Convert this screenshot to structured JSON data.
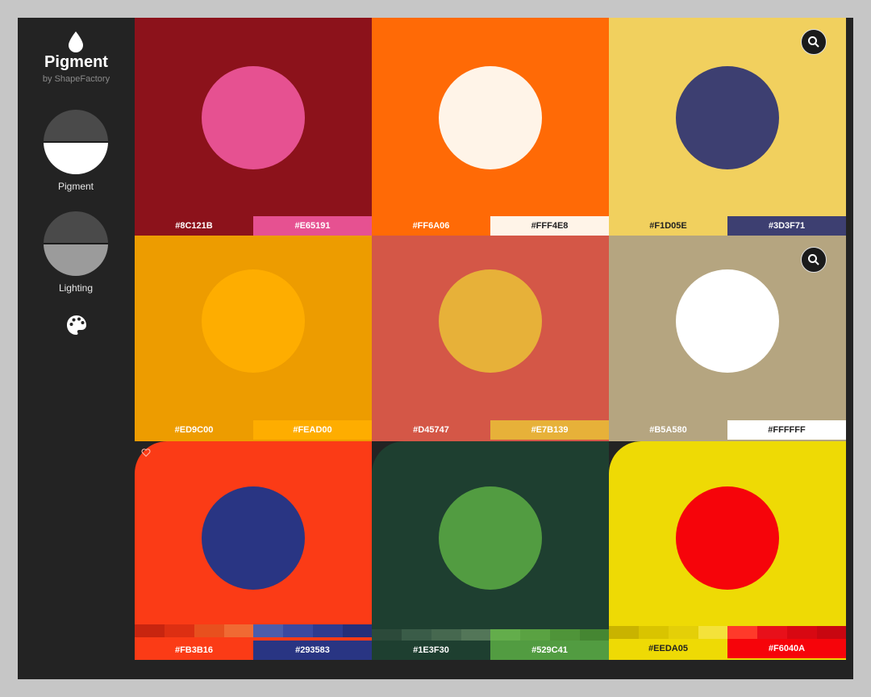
{
  "app": {
    "title": "Pigment",
    "subtitle": "by ShapeFactory"
  },
  "sidebar": {
    "tools": [
      {
        "label": "Pigment",
        "icon": "pigment-disc-icon"
      },
      {
        "label": "Lighting",
        "icon": "lighting-disc-icon"
      }
    ],
    "palette_icon": "palette-icon",
    "drop_icon": "drop-icon"
  },
  "colors": {
    "app_bg": "#232323",
    "page_bg": "#c6c6c6"
  },
  "grid": {
    "tiles": [
      {
        "bg": "#8C121B",
        "circle": "#E65191",
        "left_chip": "#8C121B",
        "right_chip": "#E65191",
        "left_text": "#ffffff",
        "right_text": "#ffffff",
        "zoom": false,
        "heart": false
      },
      {
        "bg": "#FF6A06",
        "circle": "#FFF4E8",
        "left_chip": "#FF6A06",
        "right_chip": "#FFF4E8",
        "left_text": "#ffffff",
        "right_text": "#222222",
        "zoom": false,
        "heart": false
      },
      {
        "bg": "#F1D05E",
        "circle": "#3D3F71",
        "left_chip": "#F1D05E",
        "right_chip": "#3D3F71",
        "left_text": "#222222",
        "right_text": "#ffffff",
        "zoom": true,
        "heart": false
      },
      {
        "bg": "#ED9C00",
        "circle": "#FEAD00",
        "left_chip": "#ED9C00",
        "right_chip": "#FEAD00",
        "left_text": "#ffffff",
        "right_text": "#ffffff",
        "zoom": false,
        "heart": false
      },
      {
        "bg": "#D45747",
        "circle": "#E7B139",
        "left_chip": "#D45747",
        "right_chip": "#E7B139",
        "left_text": "#ffffff",
        "right_text": "#ffffff",
        "zoom": false,
        "heart": false
      },
      {
        "bg": "#B5A580",
        "circle": "#FFFFFF",
        "left_chip": "#B5A580",
        "right_chip": "#FFFFFF",
        "left_text": "#ffffff",
        "right_text": "#222222",
        "zoom": true,
        "heart": false
      },
      {
        "bg": "#FB3B16",
        "circle": "#293583",
        "left_chip": "#FB3B16",
        "right_chip": "#293583",
        "left_text": "#ffffff",
        "right_text": "#ffffff",
        "zoom": false,
        "heart": true
      },
      {
        "bg": "#1E3F30",
        "circle": "#529C41",
        "left_chip": "#1E3F30",
        "right_chip": "#529C41",
        "left_text": "#ffffff",
        "right_text": "#ffffff",
        "zoom": false,
        "heart": false
      },
      {
        "bg": "#EEDA05",
        "circle": "#F6040A",
        "left_chip": "#EEDA05",
        "right_chip": "#F6040A",
        "left_text": "#222222",
        "right_text": "#ffffff",
        "zoom": false,
        "heart": false
      }
    ],
    "labels": [
      [
        "#8C121B",
        "#E65191"
      ],
      [
        "#FF6A06",
        "#FFF4E8"
      ],
      [
        "#F1D05E",
        "#3D3F71"
      ],
      [
        "#ED9C00",
        "#FEAD00"
      ],
      [
        "#D45747",
        "#E7B139"
      ],
      [
        "#B5A580",
        "#FFFFFF"
      ],
      [
        "#FB3B16",
        "#293583"
      ],
      [
        "#1E3F30",
        "#529C41"
      ],
      [
        "#EEDA05",
        "#F6040A"
      ]
    ],
    "stripes": [
      [
        "#c8250f",
        "#dd2f12",
        "#e8501e",
        "#f06a33"
      ],
      [
        "#4c5dab",
        "#3b49a0",
        "#2e3b8f",
        "#252f7a"
      ],
      [
        "#2c4a3a",
        "#3a5c48",
        "#46684f",
        "#537658"
      ],
      [
        "#63ad4b",
        "#5aa242",
        "#4f9439",
        "#458632"
      ],
      [
        "#c9b300",
        "#d9c400",
        "#e4cf08",
        "#f4e23a"
      ],
      [
        "#ff3a2a",
        "#e8101a",
        "#d80812",
        "#c80610"
      ]
    ]
  }
}
